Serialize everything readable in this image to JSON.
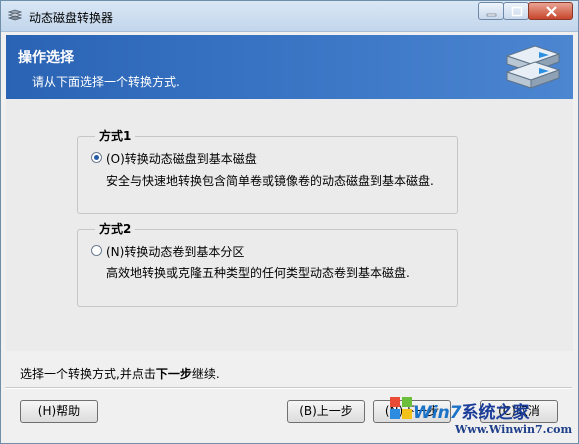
{
  "window": {
    "title": "动态磁盘转换器"
  },
  "header": {
    "title": "操作选择",
    "subtitle": "请从下面选择一个转换方式."
  },
  "options": [
    {
      "legend": "方式1",
      "label": "(O)转换动态磁盘到基本磁盘",
      "description": "安全与快速地转换包含简单卷或镜像卷的动态磁盘到基本磁盘.",
      "selected": true
    },
    {
      "legend": "方式2",
      "label": "(N)转换动态卷到基本分区",
      "description": "高效地转换或克隆五种类型的任何类型动态卷到基本磁盘.",
      "selected": false
    }
  ],
  "status": {
    "prefix": "选择一个转换方式,并点击",
    "bold": "下一步",
    "suffix": "继续."
  },
  "buttons": {
    "help": "(H)帮助",
    "back": "(B)上一步",
    "next": "(N)下一步",
    "cancel": "(C)取消"
  },
  "watermark": {
    "brand": "Win7",
    "brand_cn": "系统之家",
    "url": "Www.Winwin7.com"
  },
  "colors": {
    "header_bg": "#2f6bbd",
    "title_bar": "#c9dbee",
    "accent": "#245ca8"
  }
}
